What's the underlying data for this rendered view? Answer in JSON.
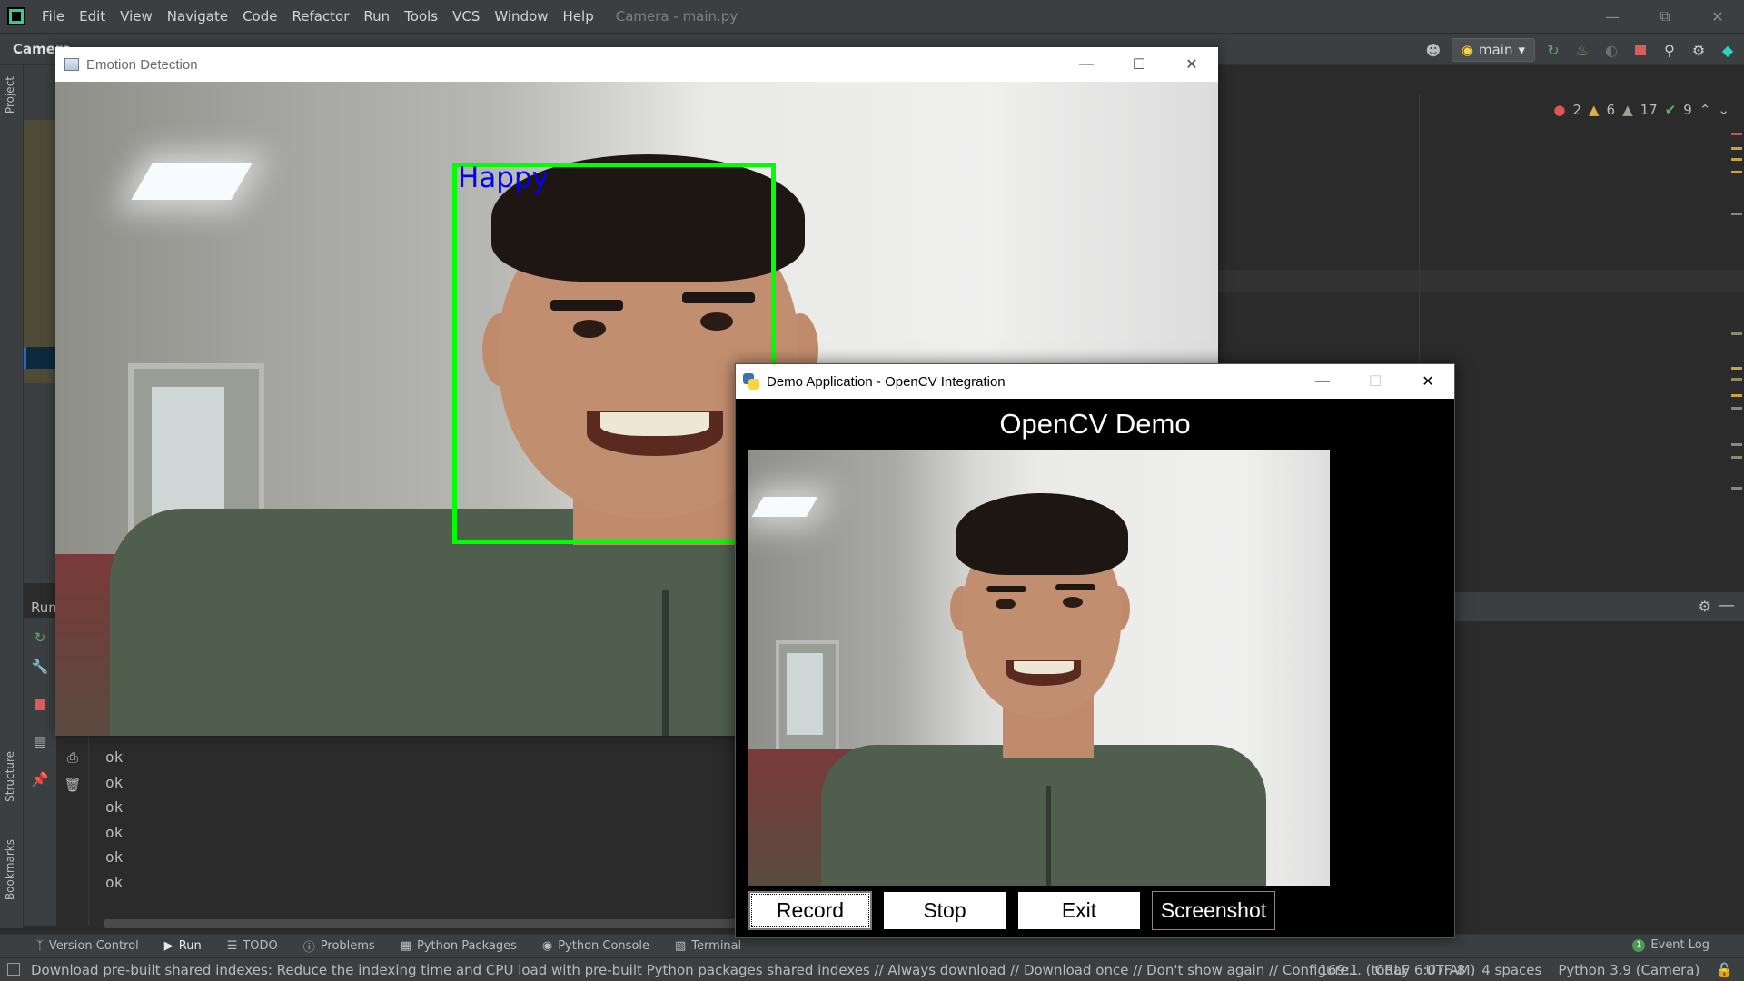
{
  "ide": {
    "menu": [
      "File",
      "Edit",
      "View",
      "Navigate",
      "Code",
      "Refactor",
      "Run",
      "Tools",
      "VCS",
      "Window",
      "Help"
    ],
    "window_title": "Camera - main.py",
    "project_name": "Camera",
    "run_config": "main",
    "sidebar_labels": {
      "project": "Project",
      "structure": "Structure",
      "bookmarks": "Bookmarks"
    },
    "run_panel_title": "Run",
    "inspections": {
      "errors": "2",
      "warnings": "6",
      "weak_warnings": "17",
      "ok": "9"
    },
    "console_lines": [
      "ok",
      "ok",
      "ok",
      "ok",
      "ok",
      "ok"
    ],
    "bottom_tabs": [
      "Version Control",
      "Run",
      "TODO",
      "Problems",
      "Python Packages",
      "Python Console",
      "Terminal"
    ],
    "event_log": {
      "label": "Event Log",
      "count": "1"
    },
    "status": {
      "message": "Download pre-built shared indexes: Reduce the indexing time and CPU load with pre-built Python packages shared indexes // Always download // Download once // Don't show again // Configure... (today 6:07 AM)",
      "position": "169:1",
      "line_separator": "CRLF",
      "encoding": "UTF-8",
      "indent": "4 spaces",
      "interpreter": "Python 3.9 (Camera)"
    }
  },
  "emotion_window": {
    "title": "Emotion Detection",
    "detected_emotion": "Happy",
    "box_color": "#00ff00",
    "label_color": "#0000ff"
  },
  "demo_window": {
    "title": "Demo Application - OpenCV Integration",
    "heading": "OpenCV Demo",
    "buttons": {
      "record": "Record",
      "stop": "Stop",
      "exit": "Exit",
      "screenshot": "Screenshot"
    }
  },
  "colors": {
    "ide_bg": "#2b2b2b",
    "ide_chrome": "#3c3f41",
    "demo_bg": "#000000"
  }
}
